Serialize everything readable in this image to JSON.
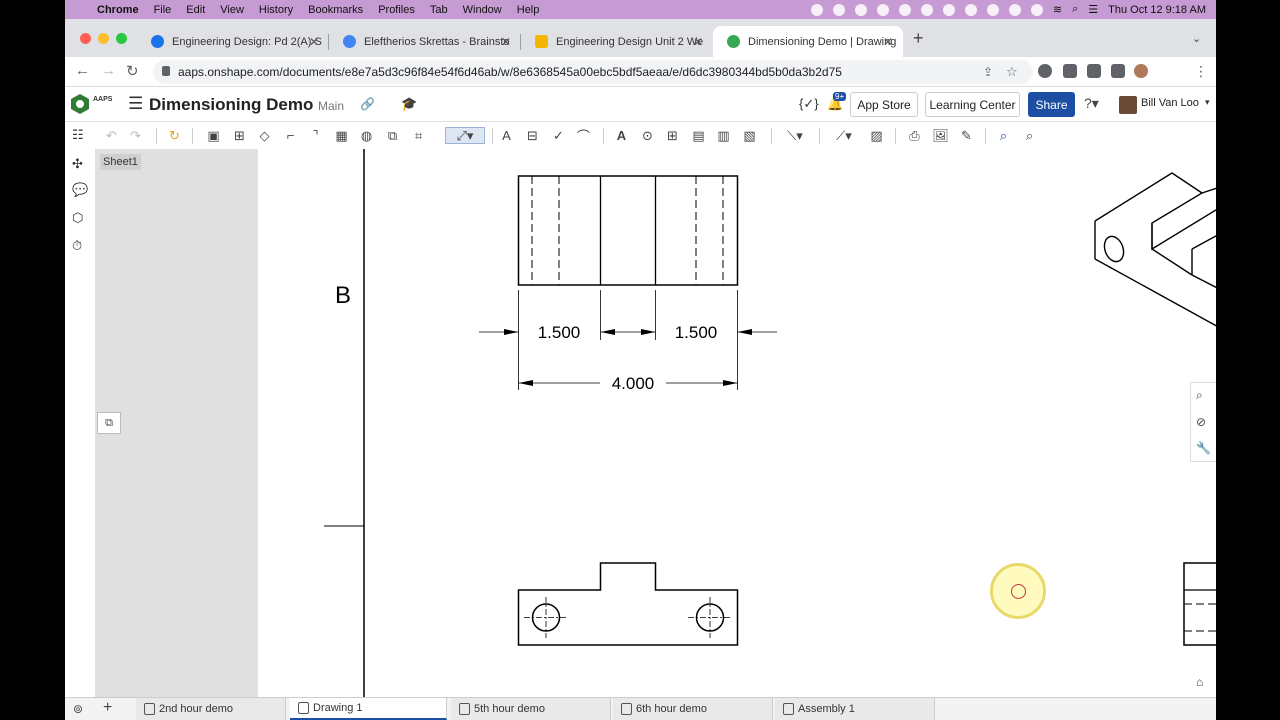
{
  "os_menu": {
    "app": "Chrome",
    "items": [
      "File",
      "Edit",
      "View",
      "History",
      "Bookmarks",
      "Profiles",
      "Tab",
      "Window",
      "Help"
    ],
    "datetime": "Thu Oct 12  9:18 AM"
  },
  "browser": {
    "tabs": [
      {
        "title": "Engineering Design: Pd 2(A) S",
        "color": "#1a73e8"
      },
      {
        "title": "Eleftherios Skrettas - Brainsto",
        "color": "#4285f4"
      },
      {
        "title": "Engineering Design Unit 2 We",
        "color": "#f4b400"
      },
      {
        "title": "Dimensioning Demo | Drawing",
        "color": "#34a853"
      }
    ],
    "url": "aaps.onshape.com/documents/e8e7a5d3c96f84e54f6d46ab/w/8e6368545a00ebc5bdf5aeaa/e/d6dc3980344bd5b0da3b2d75"
  },
  "onshape": {
    "logo_text": "AAPS",
    "document_title": "Dimensioning Demo",
    "workspace": "Main",
    "notification_count": "9+",
    "app_store_label": "App Store",
    "learning_center_label": "Learning Center",
    "share_label": "Share",
    "user_name": "Bill Van Loo",
    "accent_color": "#1c4fa3"
  },
  "sheets": {
    "active_sheet": "Sheet1"
  },
  "drawing": {
    "zone_label": "B",
    "dimensions": {
      "left_width": "1.500",
      "right_width": "1.500",
      "overall": "4.000"
    }
  },
  "bottom_tabs": [
    {
      "label": "2nd hour demo",
      "active": false
    },
    {
      "label": "Drawing 1",
      "active": true
    },
    {
      "label": "5th hour demo",
      "active": false
    },
    {
      "label": "6th hour demo",
      "active": false
    },
    {
      "label": "Assembly 1",
      "active": false
    }
  ]
}
